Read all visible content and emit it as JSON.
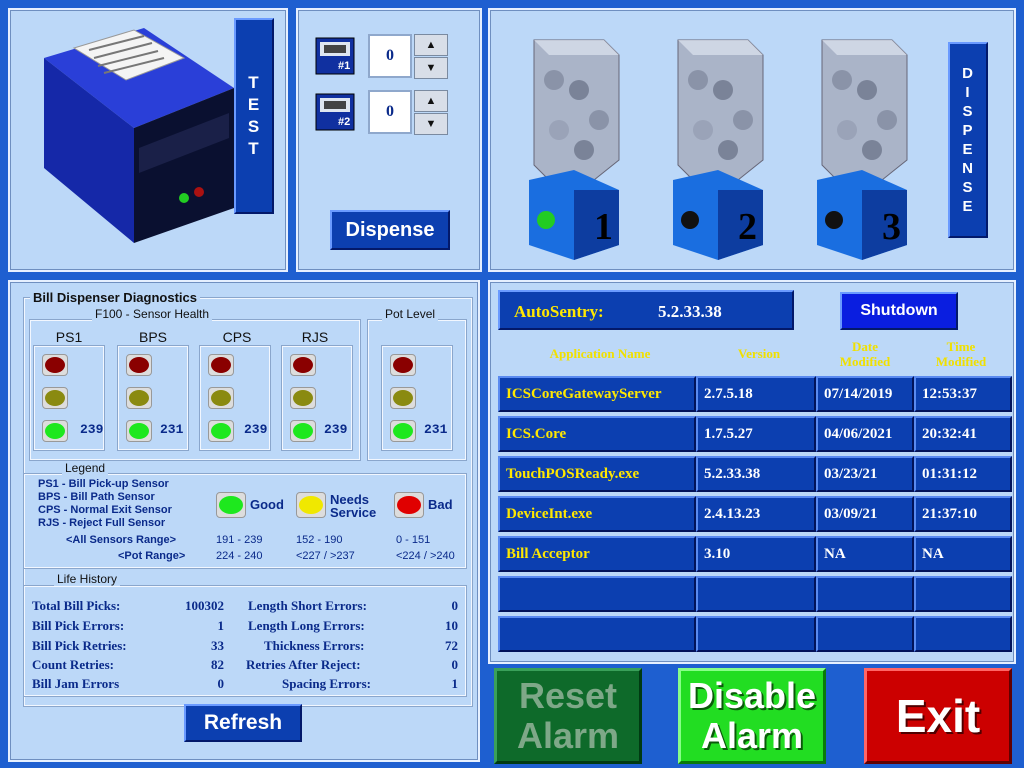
{
  "printer": {
    "test_label": "TEST"
  },
  "cassettes": [
    {
      "badge": "#1",
      "value": "0"
    },
    {
      "badge": "#2",
      "value": "0"
    }
  ],
  "dispense_label": "Dispense",
  "hoppers": [
    {
      "number": "1",
      "indicator": "green"
    },
    {
      "number": "2",
      "indicator": "black"
    },
    {
      "number": "3",
      "indicator": "black"
    }
  ],
  "dispense_vertical": "DISPENSE",
  "diagnostics": {
    "title": "Bill Dispenser Diagnostics",
    "sensor_health_title": "F100 - Sensor Health",
    "pot_level_title": "Pot Level",
    "sensors": [
      {
        "name": "PS1",
        "value": "239"
      },
      {
        "name": "BPS",
        "value": "231"
      },
      {
        "name": "CPS",
        "value": "239"
      },
      {
        "name": "RJS",
        "value": "239"
      }
    ],
    "pot_value": "231",
    "legend": {
      "title": "Legend",
      "lines": [
        "PS1  -  Bill Pick-up Sensor",
        "BPS  -  Bill Path Sensor",
        "CPS  -  Normal Exit Sensor",
        "RJS  -  Reject Full Sensor"
      ],
      "good": "Good",
      "needs": "Needs",
      "service": "Service",
      "bad": "Bad",
      "all_range_label": "<All Sensors Range>",
      "pot_range_label": "<Pot Range>",
      "all_ranges": [
        "191 - 239",
        "152 - 190",
        "0 - 151"
      ],
      "pot_ranges": [
        "224 - 240",
        "<227 / >237",
        "<224 / >240"
      ],
      "colors": {
        "good": "#1ee81e",
        "needs": "#f0e800",
        "bad": "#e00000"
      }
    },
    "life_history": {
      "title": "Life History",
      "left": [
        {
          "label": "Total Bill Picks:",
          "value": "100302"
        },
        {
          "label": "Bill Pick Errors:",
          "value": "1"
        },
        {
          "label": "Bill Pick Retries:",
          "value": "33"
        },
        {
          "label": "Count Retries:",
          "value": "82"
        },
        {
          "label": "Bill Jam Errors",
          "value": "0"
        }
      ],
      "right": [
        {
          "label": "Length Short Errors:",
          "value": "0"
        },
        {
          "label": "Length Long Errors:",
          "value": "10"
        },
        {
          "label": "Thickness Errors:",
          "value": "72"
        },
        {
          "label": "Retries After Reject:",
          "value": "0"
        },
        {
          "label": "Spacing Errors:",
          "value": "1"
        }
      ]
    },
    "refresh_label": "Refresh"
  },
  "autosentry": {
    "label": "AutoSentry:",
    "version": "5.2.33.38",
    "shutdown_label": "Shutdown",
    "headers": {
      "app": "Application Name",
      "version": "Version",
      "date1": "Date",
      "date2": "Modified",
      "time1": "Time",
      "time2": "Modified"
    },
    "rows": [
      {
        "name": "ICSCoreGatewayServer",
        "version": "2.7.5.18",
        "date": "07/14/2019",
        "time": "12:53:37"
      },
      {
        "name": "ICS.Core",
        "version": "1.7.5.27",
        "date": "04/06/2021",
        "time": "20:32:41"
      },
      {
        "name": "TouchPOSReady.exe",
        "version": "5.2.33.38",
        "date": "03/23/21",
        "time": "01:31:12"
      },
      {
        "name": "DeviceInt.exe",
        "version": "2.4.13.23",
        "date": "03/09/21",
        "time": "21:37:10"
      },
      {
        "name": "Bill Acceptor",
        "version": "3.10",
        "date": "NA",
        "time": "NA"
      },
      {
        "name": "",
        "version": "",
        "date": "",
        "time": ""
      },
      {
        "name": "",
        "version": "",
        "date": "",
        "time": ""
      }
    ]
  },
  "bottom_buttons": {
    "reset_line1": "Reset",
    "reset_line2": "Alarm",
    "disable_line1": "Disable",
    "disable_line2": "Alarm",
    "exit": "Exit",
    "colors": {
      "reset": "#0e6a2a",
      "disable": "#22dd22",
      "exit": "#cc0000"
    }
  }
}
